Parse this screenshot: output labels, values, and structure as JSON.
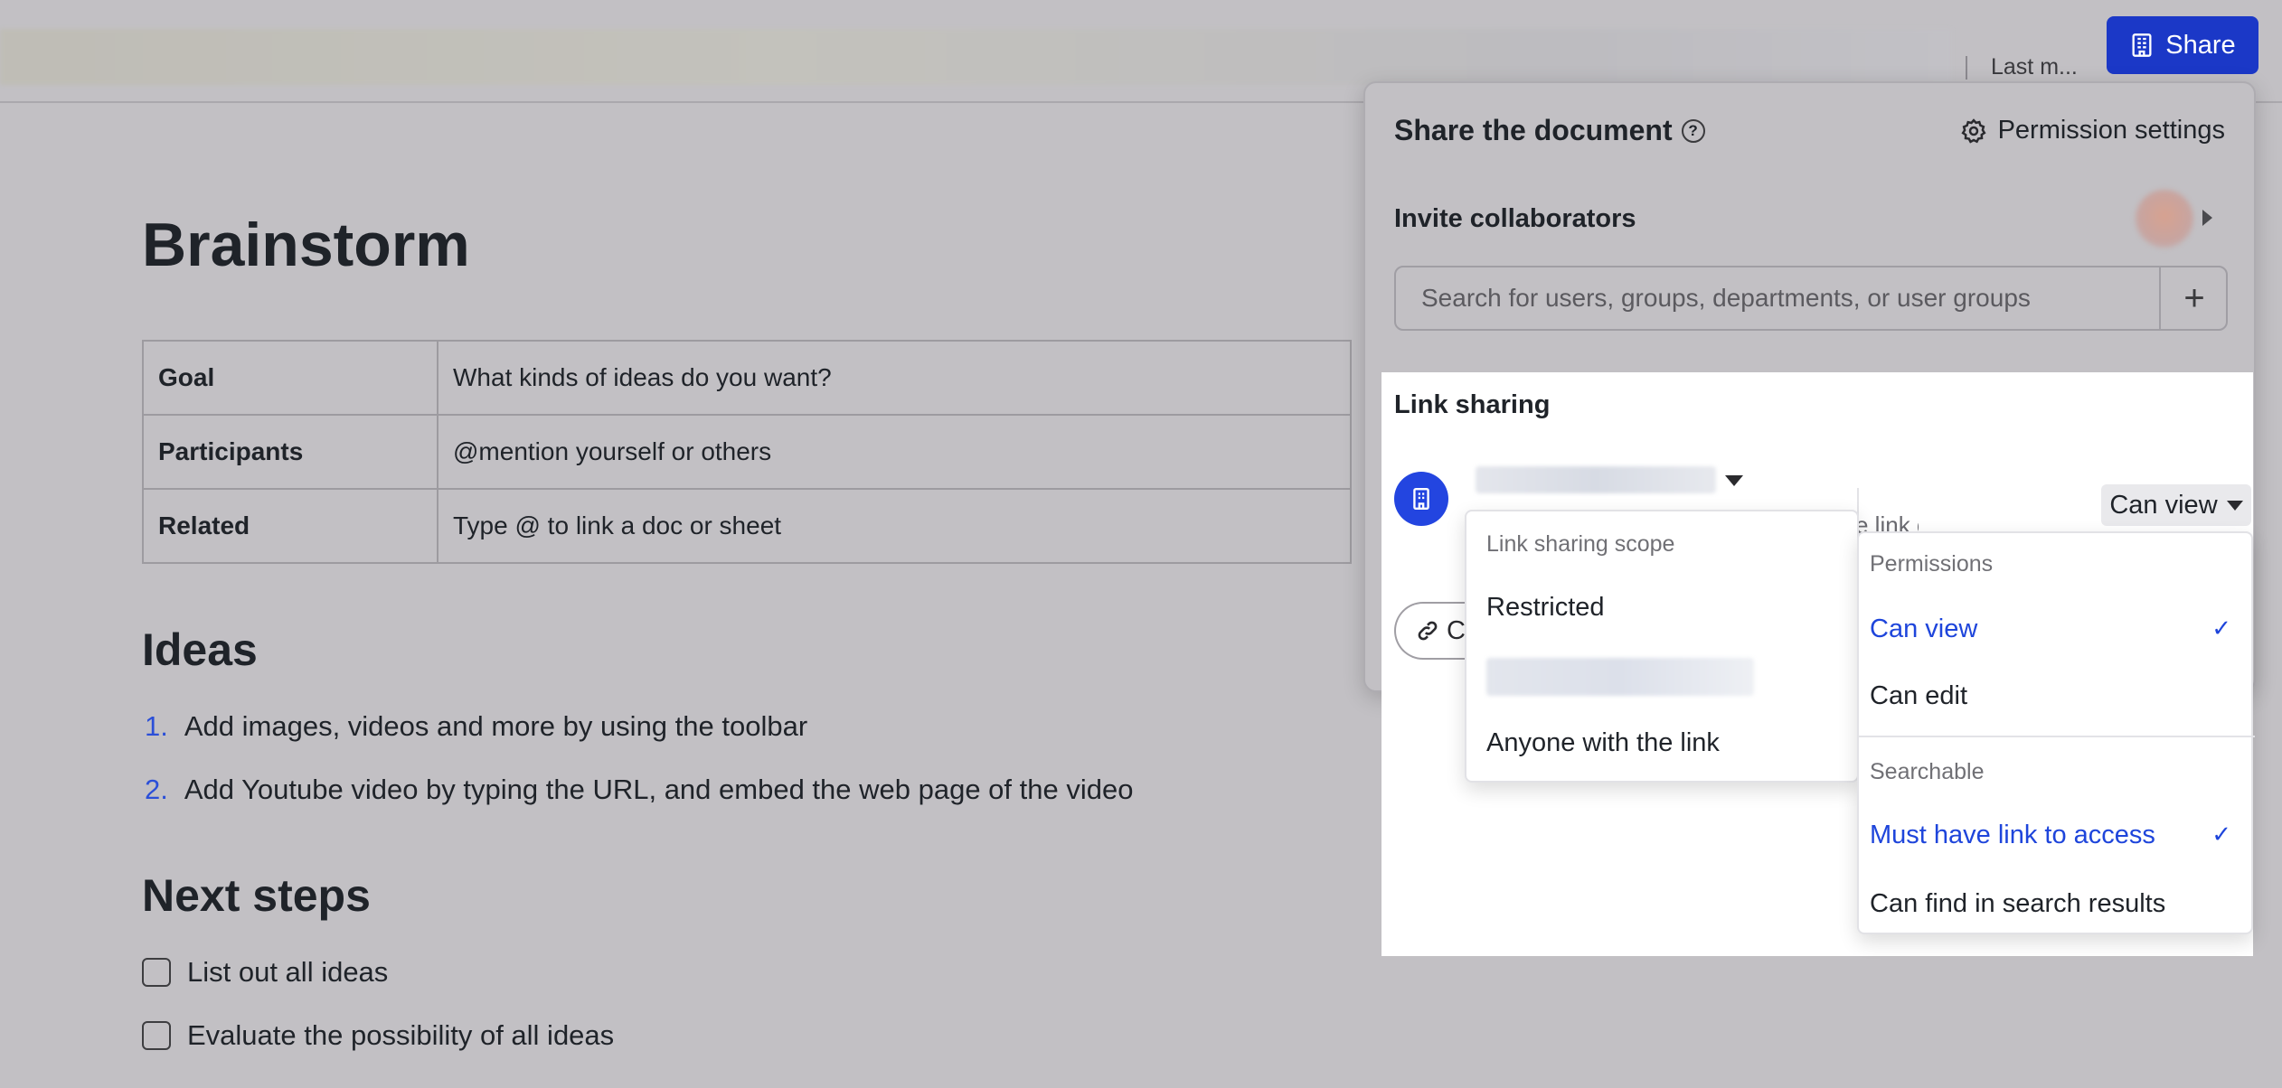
{
  "topbar": {
    "last_modified": "Last m...",
    "share_label": "Share"
  },
  "document": {
    "title": "Brainstorm",
    "table": [
      {
        "key": "Goal",
        "value": "What kinds of ideas do you want?"
      },
      {
        "key": "Participants",
        "value": "@mention yourself or others"
      },
      {
        "key": "Related",
        "value": "Type @ to link a doc or sheet"
      }
    ],
    "ideas_heading": "Ideas",
    "ideas": [
      {
        "num": "1.",
        "text": "Add images, videos and more by using the toolbar"
      },
      {
        "num": "2.",
        "text": "Add Youtube video by typing the URL, and embed the web page of the video"
      }
    ],
    "next_steps_heading": "Next steps",
    "next_steps": [
      {
        "text": "List out all ideas",
        "checked": false
      },
      {
        "text": "Evaluate the possibility of all ideas",
        "checked": false
      }
    ]
  },
  "share_panel": {
    "title": "Share the document",
    "help_glyph": "?",
    "permission_settings": "Permission settings",
    "invite_label": "Invite collaborators",
    "search_placeholder": "Search for users, groups, departments, or user groups",
    "add_glyph": "+",
    "link_sharing_title": "Link sharing",
    "partial_description": "e link can view",
    "can_view_label": "Can view",
    "copy_partial": "C"
  },
  "scope_menu": {
    "header": "Link sharing scope",
    "items": [
      "Restricted",
      "Anyone with the link"
    ]
  },
  "permissions_menu": {
    "permissions_header": "Permissions",
    "permissions": [
      {
        "label": "Can view",
        "selected": true
      },
      {
        "label": "Can edit",
        "selected": false
      }
    ],
    "searchable_header": "Searchable",
    "searchable": [
      {
        "label": "Must have link to access",
        "selected": true
      },
      {
        "label": "Can find in search results",
        "selected": false
      }
    ],
    "check_glyph": "✓"
  },
  "colors": {
    "accent": "#1b38c7",
    "selected_text": "#1e45db",
    "overlay_bg": "#c2c0c4"
  }
}
